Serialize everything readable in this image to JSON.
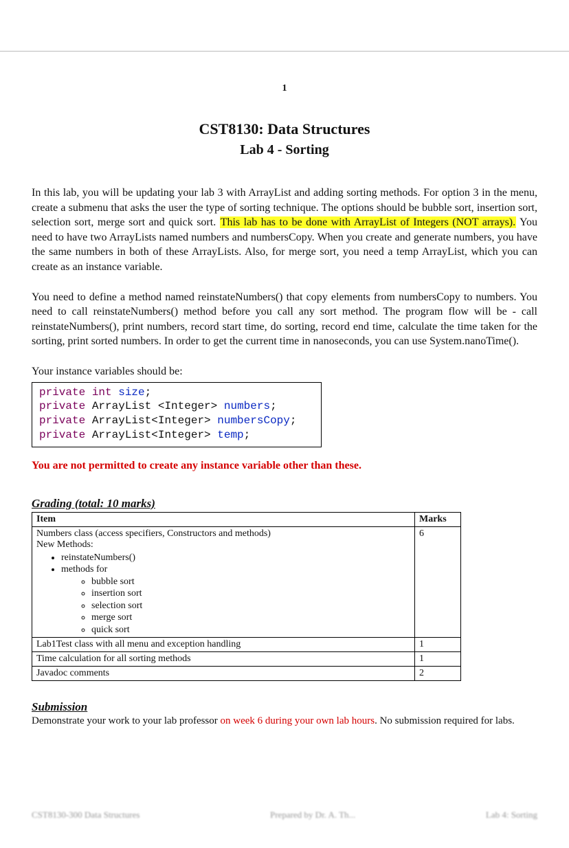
{
  "pageNumber": "1",
  "courseTitle": "CST8130:  Data Structures",
  "labTitle": "Lab 4 - Sorting",
  "para1a": "In this lab, you will be updating your lab 3 with ArrayList and adding sorting methods. For option 3 in the menu, create a submenu that asks the user the type of sorting technique. The options should be bubble sort, insertion sort, selection sort, merge sort and quick sort. ",
  "para1hl": "This lab has to be done with ArrayList of Integers (NOT arrays).",
  "para1b": " You need to have two ArrayLists named numbers and numbersCopy. When you create and generate numbers, you have the same numbers in both of these ArrayLists. Also, for merge sort, you need a temp ArrayList, which you can create as an instance variable.",
  "para2": "You need to define a method named reinstateNumbers() that copy elements from numbersCopy to numbers. You need to call reinstateNumbers() method before you call any sort method. The program flow will be - call reinstateNumbers(), print numbers, record start time, do sorting, record end time, calculate the time taken for the sorting, print sorted numbers. In order to get the current time in nanoseconds, you can use System.nanoTime().",
  "instanceLine": "Your instance variables should be:",
  "code": {
    "l1": {
      "kw": "private int",
      "name": " size",
      "end": ";"
    },
    "l2": {
      "kw": "private",
      "rest": " ArrayList <Integer> ",
      "name": "numbers",
      "end": ";"
    },
    "l3": {
      "kw": "private",
      "rest": " ArrayList<Integer> ",
      "name": "numbersCopy",
      "end": ";"
    },
    "l4": {
      "kw": "private",
      "rest": " ArrayList<Integer> ",
      "name": "temp",
      "end": ";"
    }
  },
  "warning": "You are not permitted to create any instance variable other than these.",
  "gradingHead": "Grading (total: 10 marks)",
  "table": {
    "hItem": "Item",
    "hMarks": "Marks",
    "r1": {
      "line1": "Numbers class (access specifiers, Constructors and methods)",
      "line2": "New Methods:",
      "b1": "reinstateNumbers()",
      "b2": "methods for",
      "s1": "bubble sort",
      "s2": "insertion sort",
      "s3": "selection sort",
      "s4": "merge sort",
      "s5": "quick sort",
      "marks": "6"
    },
    "r2": {
      "item": "Lab1Test class with all menu and exception handling",
      "marks": "1"
    },
    "r3": {
      "item": "Time calculation for all sorting methods",
      "marks": "1"
    },
    "r4": {
      "item": "Javadoc comments",
      "marks": "2"
    }
  },
  "submissionHead": "Submission",
  "submissionA": "Demonstrate your work to your lab professor ",
  "submissionRed": "on week 6 during your own lab hours",
  "submissionB": ". No submission required for labs.",
  "footer": {
    "left": "CST8130-300   Data Structures",
    "mid": "Prepared by  Dr. A.  Th...",
    "right": "Lab 4: Sorting"
  }
}
